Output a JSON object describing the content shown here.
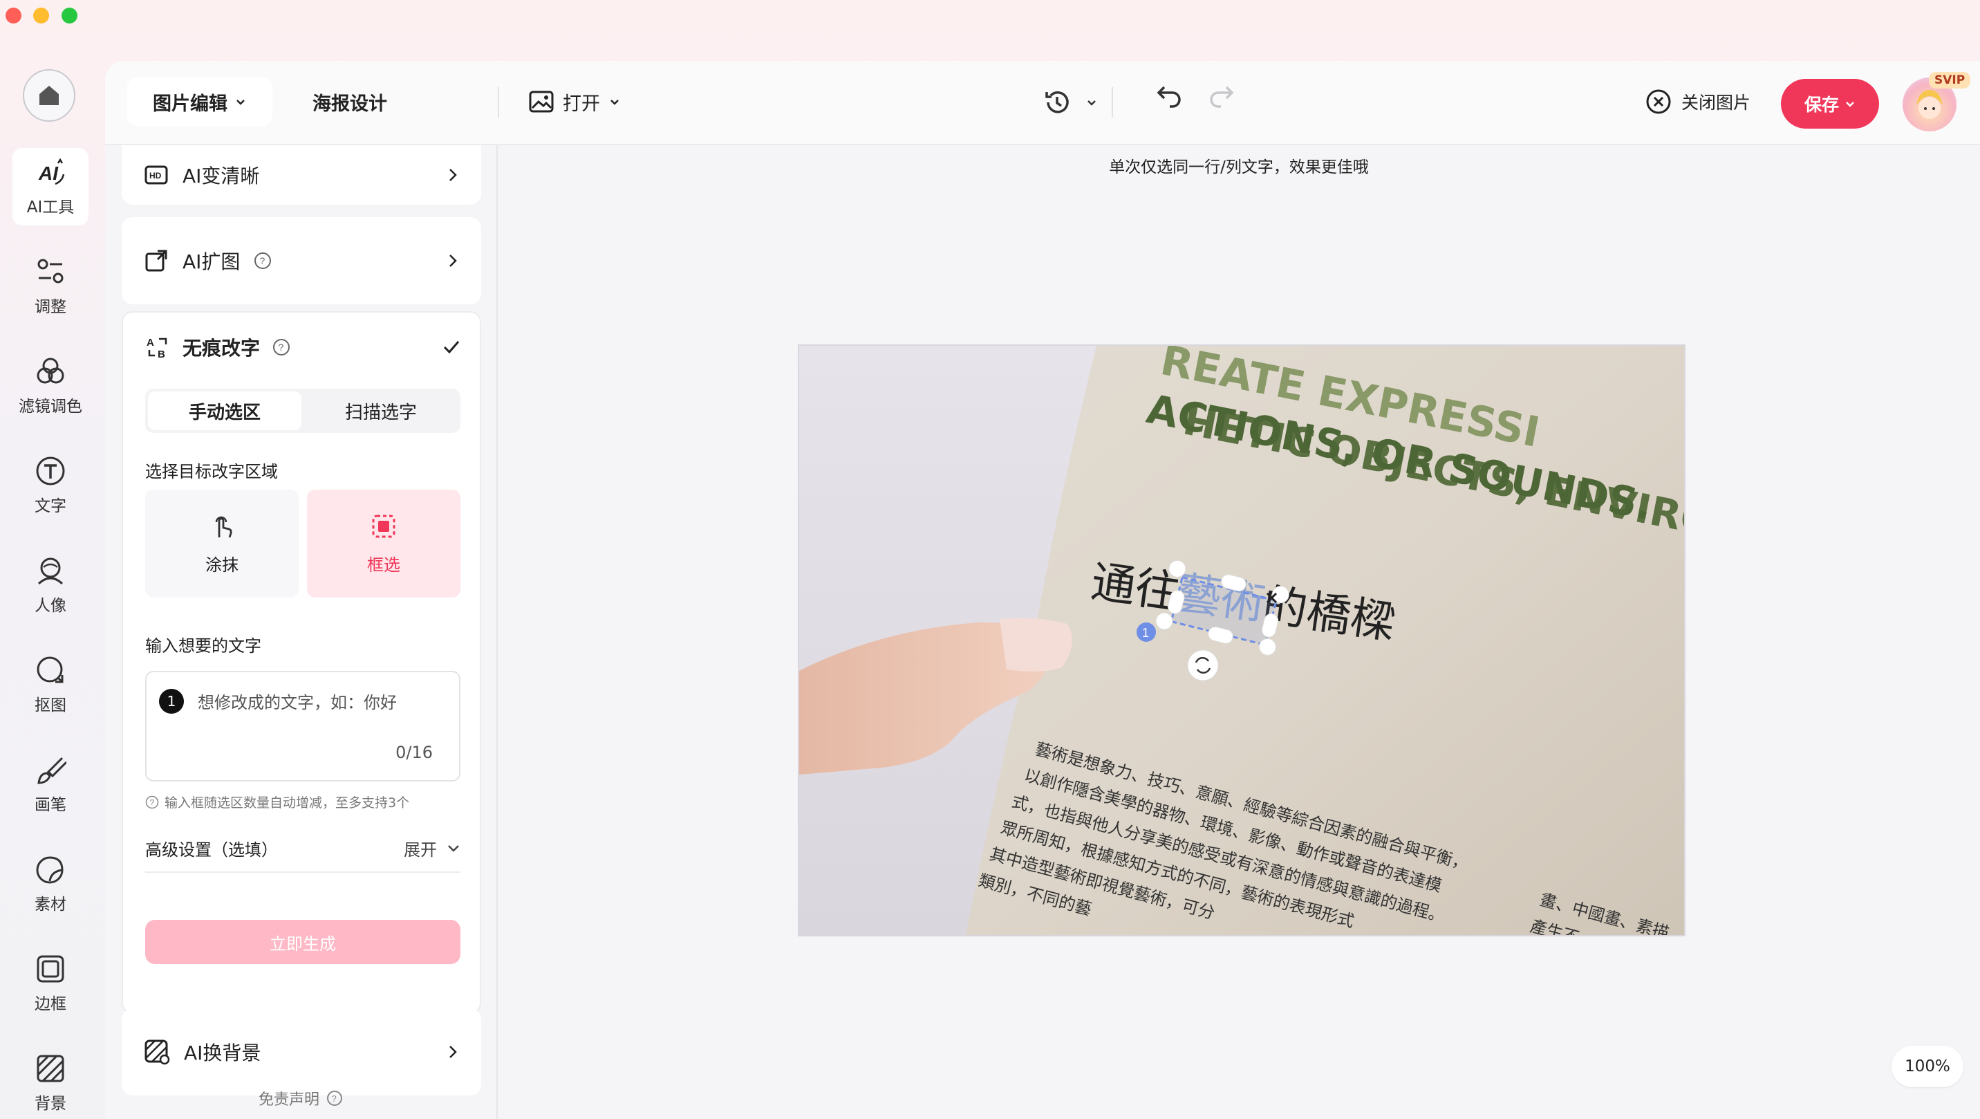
{
  "header": {
    "tab_image_edit": "图片编辑",
    "tab_poster": "海报设计",
    "open_label": "打开",
    "close_image_label": "关闭图片",
    "save_label": "保存",
    "vip_badge": "SVIP"
  },
  "rail": {
    "items": [
      {
        "label": "AI工具",
        "icon": "ai-tools-icon"
      },
      {
        "label": "调整",
        "icon": "adjust-icon"
      },
      {
        "label": "滤镜调色",
        "icon": "filter-icon"
      },
      {
        "label": "文字",
        "icon": "text-icon"
      },
      {
        "label": "人像",
        "icon": "portrait-icon"
      },
      {
        "label": "抠图",
        "icon": "cutout-icon"
      },
      {
        "label": "画笔",
        "icon": "brush-icon"
      },
      {
        "label": "素材",
        "icon": "sticker-icon"
      },
      {
        "label": "边框",
        "icon": "frame-icon"
      },
      {
        "label": "背景",
        "icon": "background-icon"
      }
    ]
  },
  "panel": {
    "ai_clear": "AI变清晰",
    "ai_expand": "AI扩图",
    "seamless_text": {
      "title": "无痕改字",
      "tab_manual": "手动选区",
      "tab_scan": "扫描选字",
      "select_region_label": "选择目标改字区域",
      "mode_smear": "涂抹",
      "mode_box": "框选",
      "input_label": "输入想要的文字",
      "input_badge": "1",
      "input_placeholder": "想修改成的文字，如：你好",
      "input_count": "0/16",
      "hint": "输入框随选区数量自动增减，至多支持3个",
      "advanced_label": "高级设置（选填）",
      "expand_label": "展开",
      "generate_label": "立即生成"
    },
    "ai_bg": "AI换背景",
    "disclaimer": "免责声明"
  },
  "canvas": {
    "tip": "单次仅选同一行/列文字，效果更佳哦",
    "zoom": "100%",
    "photo_text": {
      "line1": "HETIC OBJECTS, ENVIRON",
      "line0": "REATE EXPRESSI",
      "line2": "ACTIONS, OR SOUNDS.",
      "title_left": "通往",
      "title_selected": "藝術",
      "title_right": "的橋樑",
      "selection_index": "1",
      "body1": "藝術是想象力、技巧、意願、經驗等綜合因素的融合與平衡，",
      "body2": "以創作隱含美學的器物、環境、影像、動作或聲音的表達模",
      "body3": "式，也指與他人分享美的感受或有深意的情感與意識的過程。",
      "body4": "眾所周知，根據感知方式的不同，藝術的表現形式",
      "body5": "其中造型藝術即視覺藝術，可分",
      "body6": "類別，不同的藝",
      "body_right1": "畫、中國畫、素描",
      "body_right2": "產生不"
    }
  },
  "colors": {
    "accent": "#f03659",
    "box_mode_bg": "#ffe7eb",
    "generate_disabled": "#ffb8c5"
  }
}
